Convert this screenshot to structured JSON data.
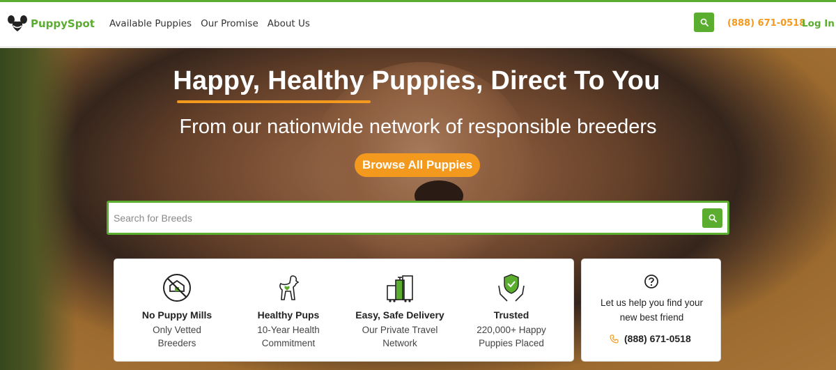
{
  "brand": {
    "name": "PuppySpot",
    "green": "#5aad2f",
    "orange": "#f39a1e"
  },
  "nav": {
    "items": [
      {
        "label": "Available Puppies"
      },
      {
        "label": "Our Promise"
      },
      {
        "label": "About Us"
      }
    ],
    "phone": "(888) 671-0518",
    "login": "Log In"
  },
  "hero": {
    "title": "Happy, Healthy Puppies, Direct To You",
    "subtitle": "From our nationwide network of responsible breeders",
    "cta": "Browse All Puppies"
  },
  "search": {
    "placeholder": "Search for Breeds",
    "value": ""
  },
  "features": [
    {
      "icon": "no-puppy-mills-icon",
      "title": "No Puppy Mills",
      "desc_line1": "Only Vetted",
      "desc_line2": "Breeders"
    },
    {
      "icon": "healthy-dog-icon",
      "title": "Healthy Pups",
      "desc_line1": "10-Year Health",
      "desc_line2": "Commitment"
    },
    {
      "icon": "luggage-icon",
      "title": "Easy, Safe Delivery",
      "desc_line1": "Our Private Travel",
      "desc_line2": "Network"
    },
    {
      "icon": "shield-hands-icon",
      "title": "Trusted",
      "desc_line1": "220,000+ Happy",
      "desc_line2": "Puppies Placed"
    }
  ],
  "help": {
    "icon": "question-icon",
    "text_line1": "Let us help you find your",
    "text_line2": "new best friend",
    "phone": "(888) 671-0518"
  }
}
